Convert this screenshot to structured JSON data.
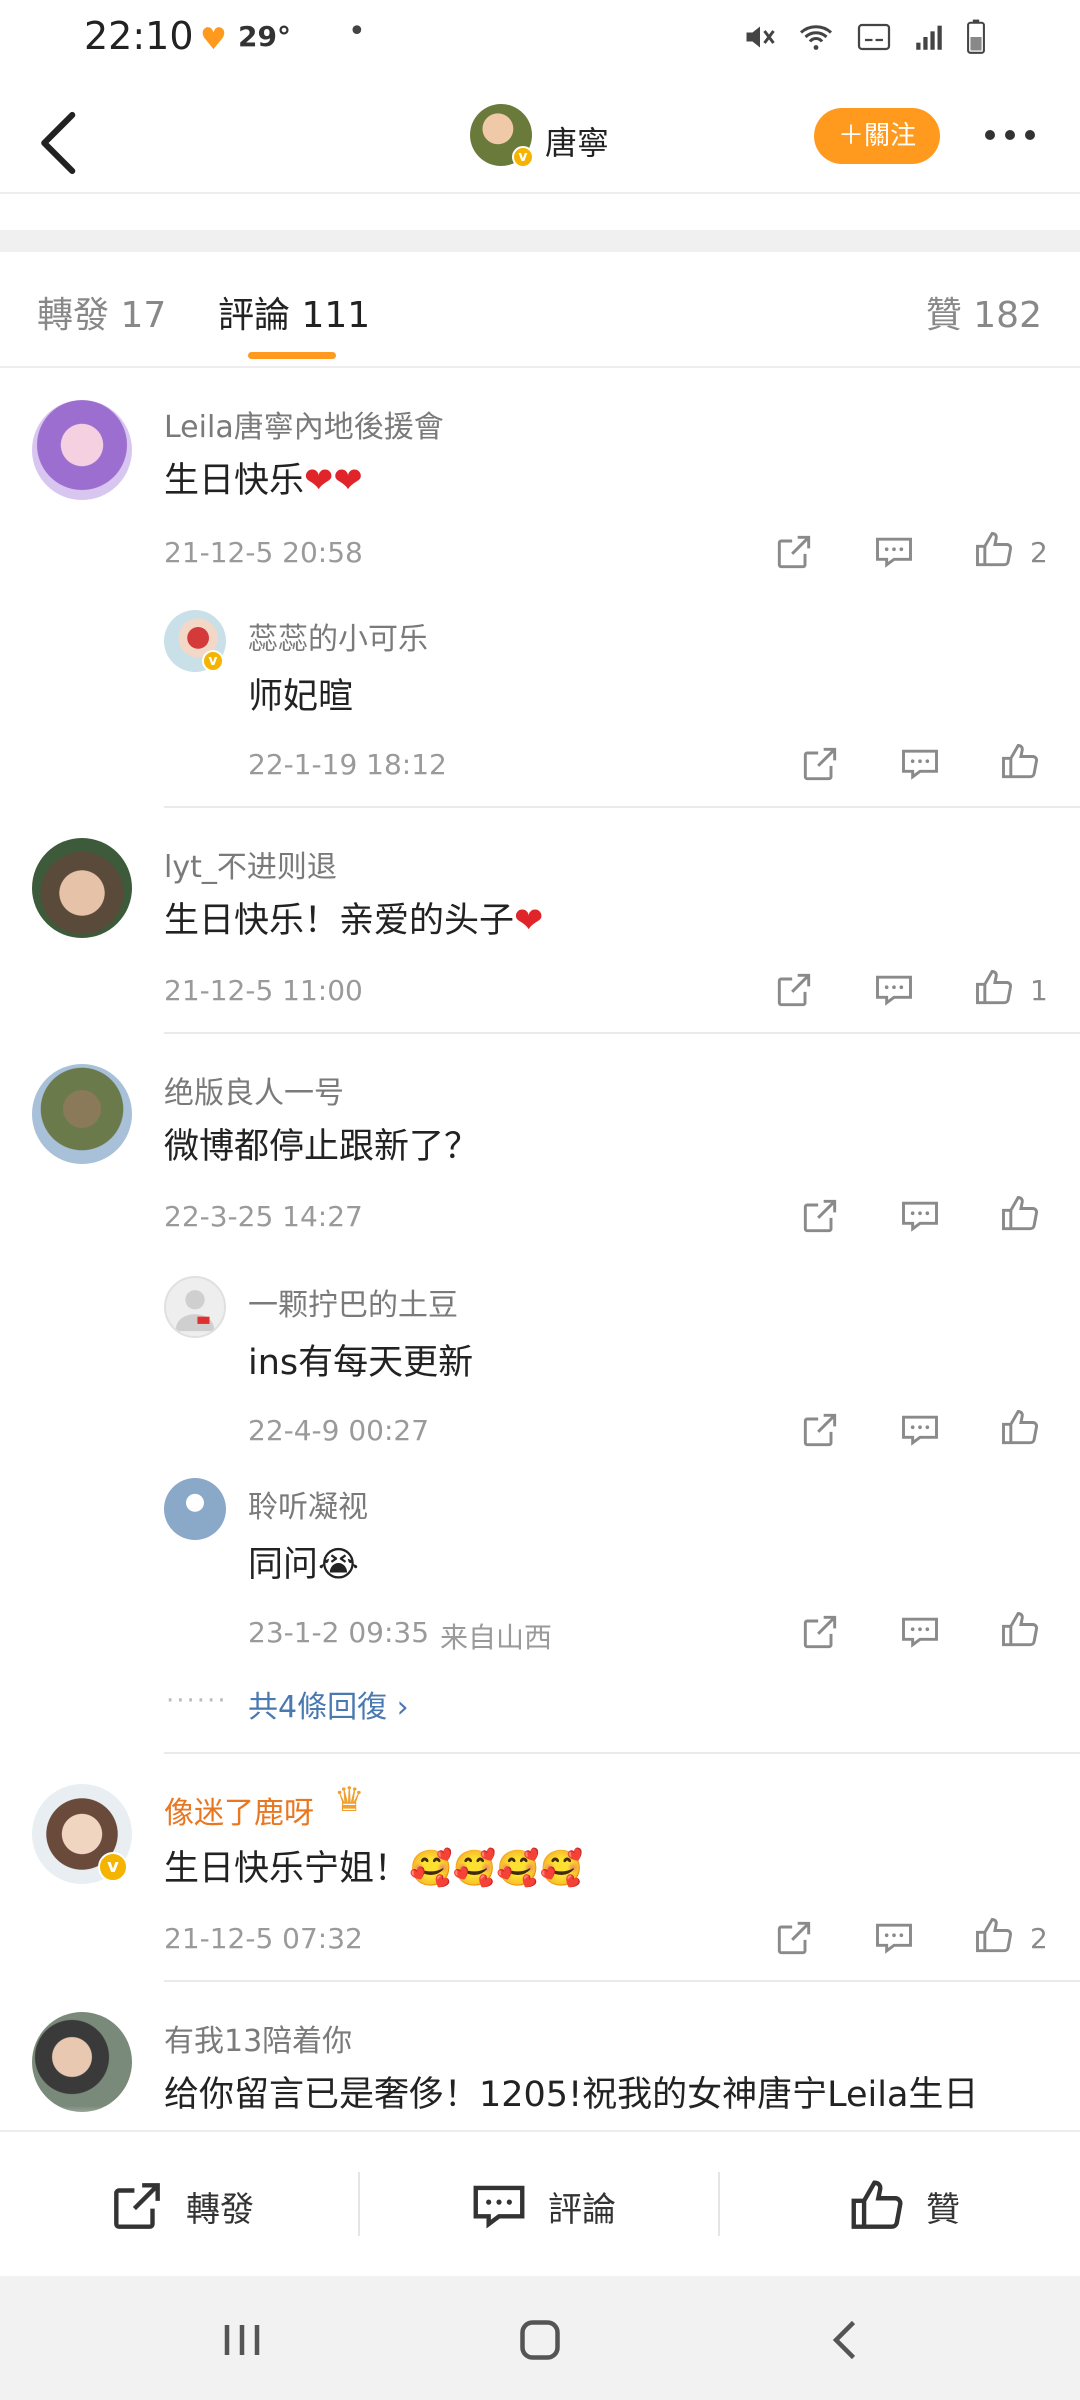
{
  "status_bar": {
    "time": "22:10",
    "weather": "29°"
  },
  "header": {
    "user_name": "唐寧",
    "follow_label": "＋關注"
  },
  "tabs": [
    {
      "label": "轉發 17"
    },
    {
      "label": "評論 111"
    },
    {
      "label": "贊 182"
    }
  ],
  "comments": [
    {
      "nick": "Leila唐寧內地後援會",
      "text": "生日快乐",
      "emoji": "❤❤",
      "time": "21-12-5 20:58",
      "likes": "2"
    },
    {
      "nick": "蕊蕊的小可乐",
      "text": "师妃暄",
      "time": "22-1-19 18:12"
    },
    {
      "nick": "lyt_不进则退",
      "text": "生日快乐！亲爱的头子",
      "emoji": "❤",
      "time": "21-12-5 11:00",
      "likes": "1"
    },
    {
      "nick": "绝版良人一号",
      "text": "微博都停止跟新了？",
      "time": "22-3-25 14:27"
    },
    {
      "nick": "一颗拧巴的土豆",
      "text": "ins有每天更新",
      "time": "22-4-9 00:27"
    },
    {
      "nick": "聆听凝视",
      "text": "同问😭",
      "time": "23-1-2 09:35",
      "location": "来自山西"
    },
    {
      "more_replies": "共4條回復 ›"
    },
    {
      "nick": "像迷了鹿呀",
      "text": "生日快乐宁姐！🥰🥰🥰🥰",
      "time": "21-12-5 07:32",
      "likes": "2"
    },
    {
      "nick": "有我13陪着你",
      "text": "给你留言已是奢侈！1205!祝我的女神唐宁Leila生日"
    }
  ],
  "bottom_bar": {
    "repost": "轉發",
    "comment": "評論",
    "like": "贊"
  },
  "colors": {
    "accent": "#ff9a1e",
    "link": "#4a78b0",
    "vip_name": "#e87722"
  }
}
